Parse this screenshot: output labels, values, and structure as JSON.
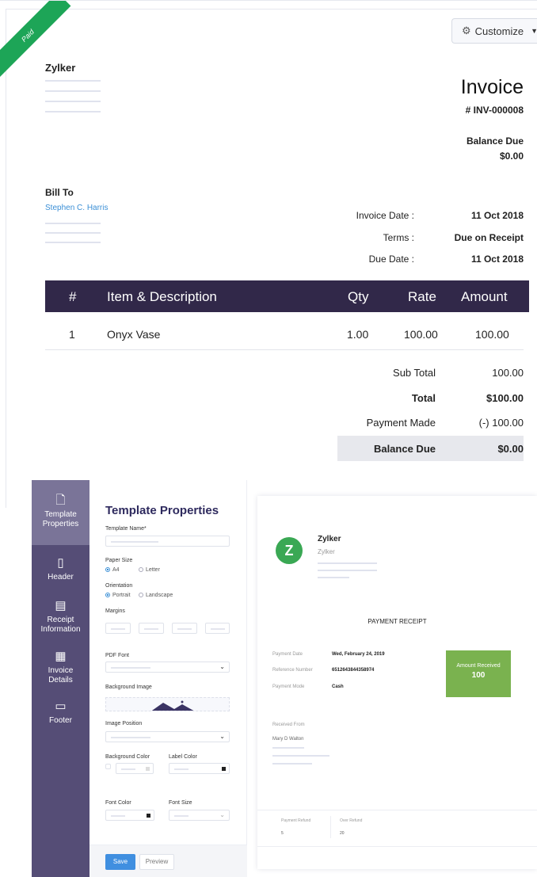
{
  "invoice": {
    "status_ribbon": "Paid",
    "customize_label": "Customize",
    "company_name": "Zylker",
    "title": "Invoice",
    "number": "# INV-000008",
    "balance_due_label": "Balance Due",
    "balance_due_value": "$0.00",
    "bill_to_label": "Bill To",
    "customer_name": "Stephen C. Harris",
    "meta": [
      {
        "label": "Invoice Date :",
        "value": "11 Oct 2018"
      },
      {
        "label": "Terms :",
        "value": "Due on Receipt"
      },
      {
        "label": "Due Date :",
        "value": "11 Oct 2018"
      }
    ],
    "table": {
      "headers": [
        "#",
        "Item & Description",
        "Qty",
        "Rate",
        "Amount"
      ],
      "rows": [
        {
          "num": "1",
          "item": "Onyx Vase",
          "qty": "1.00",
          "rate": "100.00",
          "amount": "100.00"
        }
      ]
    },
    "totals": [
      {
        "label": "Sub Total",
        "value": "100.00"
      },
      {
        "label": "Total",
        "value": "$100.00"
      },
      {
        "label": "Payment Made",
        "value": "(-) 100.00"
      },
      {
        "label": "Balance Due",
        "value": "$0.00"
      }
    ],
    "colors": {
      "ribbon": "#1da557",
      "table_header": "#312849",
      "link": "#3b8fd6"
    }
  },
  "editor": {
    "sidebar": [
      {
        "label_line1": "Template",
        "label_line2": "Properties",
        "icon": "document-icon"
      },
      {
        "label_line1": "Header",
        "label_line2": "",
        "icon": "tablet-icon"
      },
      {
        "label_line1": "Receipt",
        "label_line2": "Information",
        "icon": "receipt-icon"
      },
      {
        "label_line1": "Invoice",
        "label_line2": "Details",
        "icon": "invoice-doc-icon"
      },
      {
        "label_line1": "Footer",
        "label_line2": "",
        "icon": "footer-icon"
      }
    ],
    "props": {
      "title": "Template Properties",
      "template_name_label": "Template Name*",
      "paper_size_label": "Paper Size",
      "paper_a4": "A4",
      "paper_letter": "Letter",
      "orientation_label": "Orientation",
      "portrait": "Portrait",
      "landscape": "Landscape",
      "margins_label": "Margins",
      "pdf_font_label": "PDF Font",
      "bg_image_label": "Background Image",
      "image_position_label": "Image Position",
      "bg_color_label": "Background Color",
      "label_color_label": "Label Color",
      "font_color_label": "Font Color",
      "font_size_label": "Font Size",
      "save_label": "Save",
      "preview_label": "Preview"
    },
    "receipt": {
      "logo_letter": "Z",
      "company": "Zylker",
      "company_sub": "Zylker",
      "title": "PAYMENT RECEIPT",
      "fields": [
        {
          "label": "Payment Date",
          "value": "Wed, February 24, 2019"
        },
        {
          "label": "Reference Number",
          "value": "6512643844358974"
        },
        {
          "label": "Payment Mode",
          "value": "Cash"
        }
      ],
      "amount_label": "Amount Received",
      "amount_value": "100",
      "received_from_label": "Received From",
      "received_from_name": "Mary D Walton",
      "refund_label": "Payment Refund",
      "refund_value": "5",
      "over_refund_label": "Over Refund",
      "over_refund_value": "20"
    },
    "colors": {
      "sidebar": "#554d76",
      "save": "#408fe0",
      "amount_box": "#7ab24f",
      "logo": "#3aa854"
    }
  }
}
